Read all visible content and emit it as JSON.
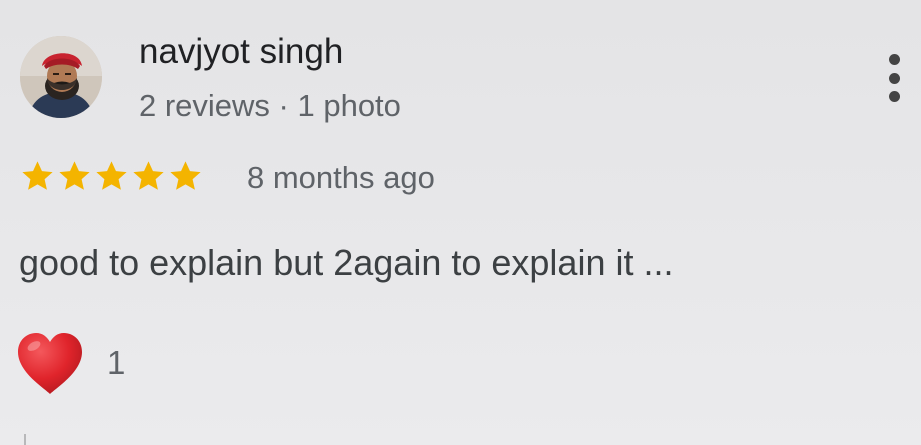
{
  "review": {
    "reviewer_name": "navjyot singh",
    "reviewer_meta": "2 reviews · 1 photo",
    "rating": 5,
    "rating_max": 5,
    "time_ago": "8 months ago",
    "text": "good to explain but 2again to explain it ...",
    "like_count": "1"
  },
  "icons": {
    "more": "more-vert-icon",
    "star": "star-icon",
    "heart": "heart-icon"
  },
  "colors": {
    "star": "#f4b400",
    "heart": "#e0242b",
    "background": "#e6e6e8"
  }
}
